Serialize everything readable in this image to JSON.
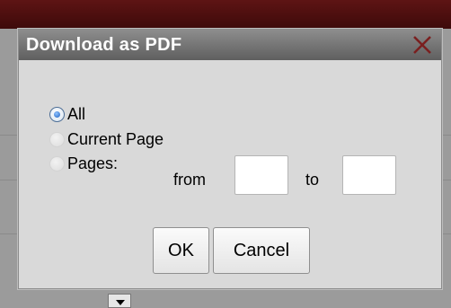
{
  "dialog": {
    "title": "Download as PDF",
    "close_icon": "close-icon",
    "options": [
      {
        "label": "All",
        "checked": true
      },
      {
        "label": "Current Page",
        "checked": false
      },
      {
        "label": "Pages:",
        "checked": false
      }
    ],
    "pages": {
      "from_label": "from",
      "to_label": "to",
      "from_value": "",
      "to_value": ""
    },
    "buttons": {
      "ok_label": "OK",
      "cancel_label": "Cancel"
    }
  },
  "colors": {
    "titlebar": "#6f6f6f",
    "close": "#7a1f1f",
    "radio_selected": "#1d5fbf"
  }
}
